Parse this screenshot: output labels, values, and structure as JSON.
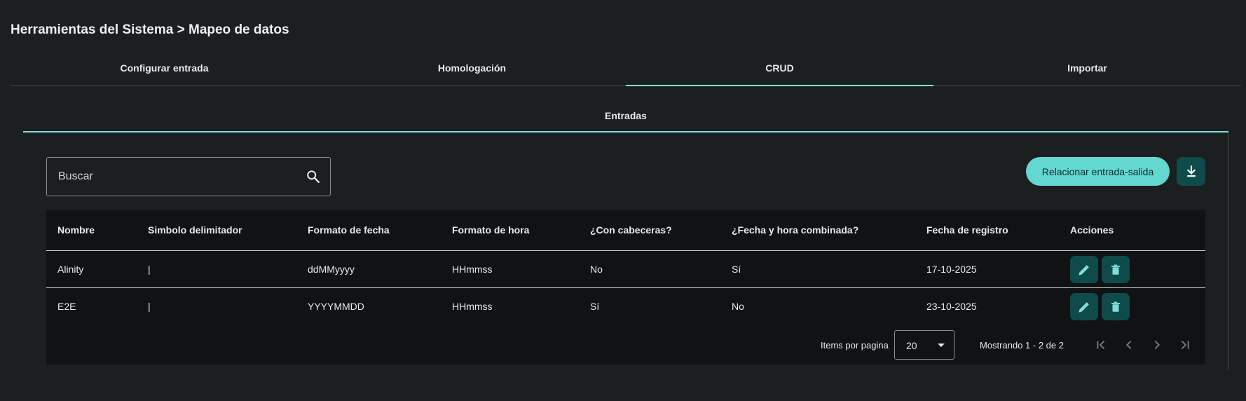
{
  "header": {
    "title": "Herramientas del Sistema > Mapeo de datos"
  },
  "tabs": [
    {
      "label": "Configurar entrada"
    },
    {
      "label": "Homologación"
    },
    {
      "label": "CRUD"
    },
    {
      "label": "Importar"
    }
  ],
  "subtabs": [
    {
      "label": "Entradas"
    }
  ],
  "search": {
    "placeholder": "Buscar",
    "value": ""
  },
  "toolbar": {
    "relate_label": "Relacionar entrada-salida"
  },
  "table": {
    "columns": [
      "Nombre",
      "Simbolo delimitador",
      "Formato de fecha",
      "Formato de hora",
      "¿Con cabeceras?",
      "¿Fecha y hora combinada?",
      "Fecha de registro",
      "Acciones"
    ],
    "rows": [
      [
        "Alinity",
        "|",
        "ddMMyyyy",
        "HHmmss",
        "No",
        "Sí",
        "17-10-2025"
      ],
      [
        "E2E",
        "|",
        "YYYYMMDD",
        "HHmmss",
        "Sí",
        "No",
        "23-10-2025"
      ]
    ]
  },
  "pagination": {
    "items_label": "Items por pagina",
    "page_size": "20",
    "range_label": "Mostrando 1 - 2 de 2"
  },
  "colors": {
    "accent": "#7fdedd",
    "button_primary": "#63d8d0",
    "button_dark": "#0e4b4a",
    "background": "#1b1f20"
  }
}
